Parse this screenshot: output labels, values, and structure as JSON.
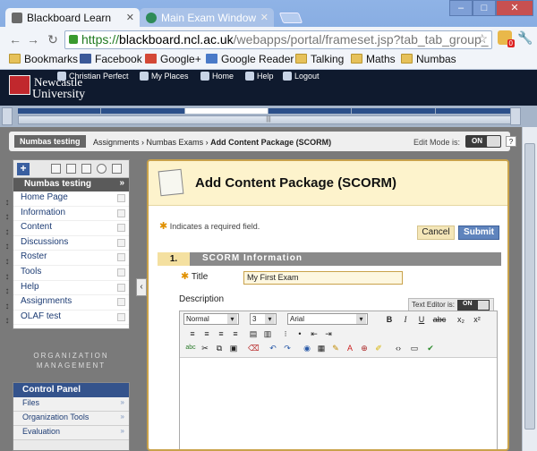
{
  "browser": {
    "tabs": [
      {
        "label": "Blackboard Learn",
        "active": true
      },
      {
        "label": "Main Exam Window",
        "active": false
      }
    ],
    "url": {
      "scheme": "https://",
      "host": "blackboard.ncl.ac.uk",
      "path": "/webapps/portal/frameset.jsp?tab_tab_group_"
    },
    "extension_badge": "0",
    "bookmarks": [
      {
        "label": "Bookmarks",
        "icon": "folder-icon"
      },
      {
        "label": "Facebook",
        "icon": "facebook-icon"
      },
      {
        "label": "Google+",
        "icon": "google-plus-icon"
      },
      {
        "label": "Google Reader",
        "icon": "google-reader-icon"
      },
      {
        "label": "Talking",
        "icon": "folder-icon"
      },
      {
        "label": "Maths",
        "icon": "folder-icon"
      },
      {
        "label": "Numbas",
        "icon": "folder-icon"
      }
    ]
  },
  "header": {
    "logo_line1": "Newcastle",
    "logo_line2": "University",
    "links": [
      {
        "label": "Christian Perfect"
      },
      {
        "label": "My Places"
      },
      {
        "label": "Home"
      },
      {
        "label": "Help"
      },
      {
        "label": "Logout"
      }
    ],
    "handle_glyph": "|||"
  },
  "breadcrumb": {
    "course": "Numbas testing",
    "items": [
      "Assignments",
      "Numbas Exams"
    ],
    "current": "Add Content Package (SCORM)",
    "edit_mode_label": "Edit Mode is:",
    "edit_mode_value": "ON",
    "help": "?"
  },
  "course_menu": {
    "title": "Numbas testing",
    "items": [
      "Home Page",
      "Information",
      "Content",
      "Discussions",
      "Roster",
      "Tools",
      "Help",
      "Assignments",
      "OLAF test"
    ]
  },
  "org_management": {
    "line1": "ORGANIZATION",
    "line2": "MANAGEMENT"
  },
  "control_panel": {
    "title": "Control Panel",
    "items": [
      "Files",
      "Organization Tools",
      "Evaluation"
    ]
  },
  "form": {
    "title": "Add Content Package (SCORM)",
    "required_note": "Indicates a required field.",
    "cancel": "Cancel",
    "submit": "Submit",
    "section_number": "1.",
    "section_title": "SCORM Information",
    "title_label": "Title",
    "title_value": "My First Exam",
    "description_label": "Description",
    "text_editor_label": "Text Editor is:",
    "text_editor_value": "ON",
    "format": "Normal",
    "size": "3",
    "font": "Arial"
  },
  "colors": {
    "header_bg": "#0f1a2e",
    "accent_blue": "#34538c",
    "section_gray": "#8a8a8a",
    "required_star": "#e09000"
  }
}
